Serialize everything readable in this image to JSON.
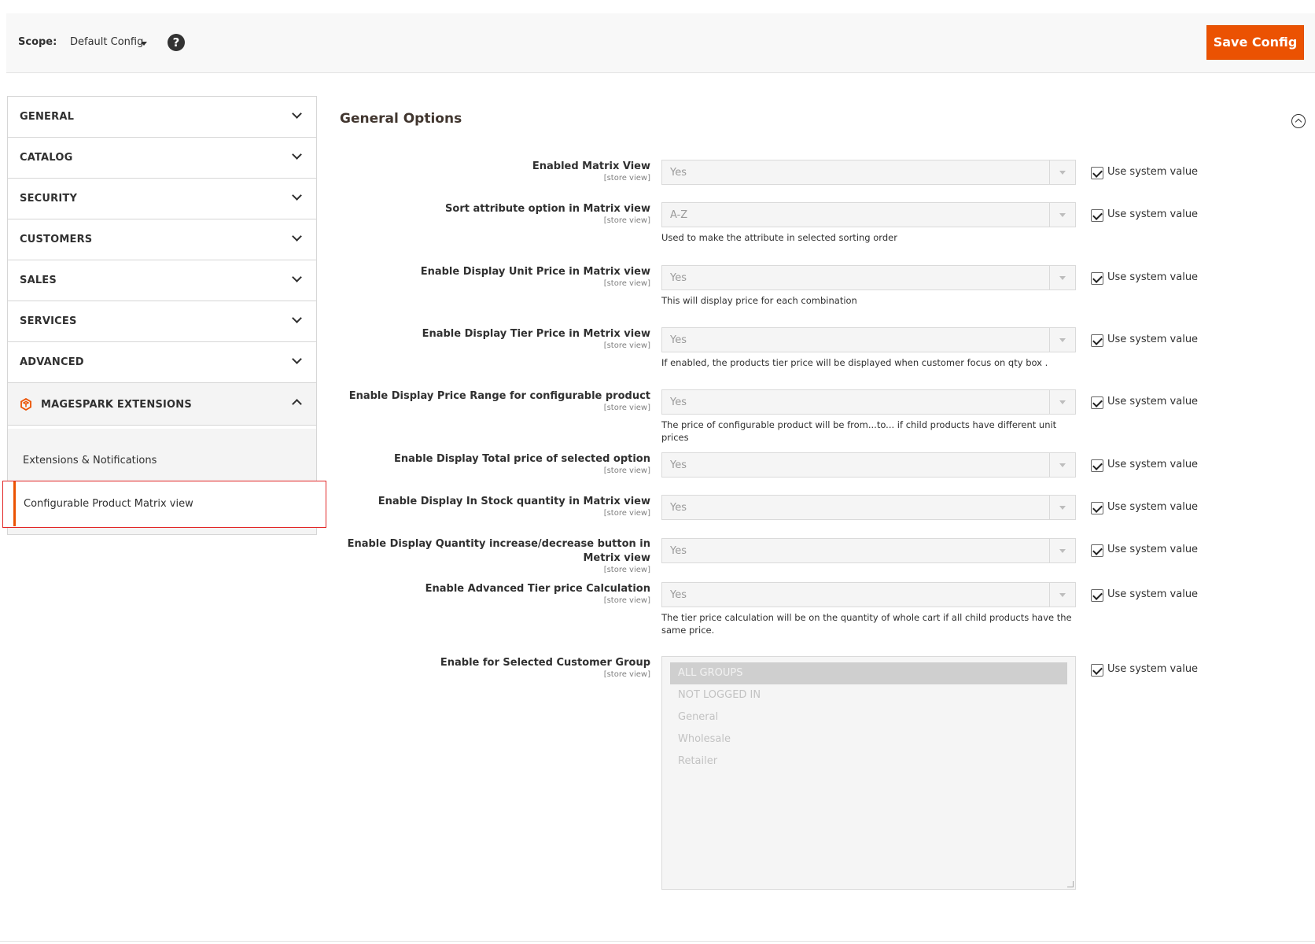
{
  "scope": {
    "label": "Scope:",
    "value": "Default Config",
    "help_icon": "question-circle-icon"
  },
  "header": {
    "save_label": "Save Config"
  },
  "sidebar": {
    "items": [
      {
        "label": "GENERAL"
      },
      {
        "label": "CATALOG"
      },
      {
        "label": "SECURITY"
      },
      {
        "label": "CUSTOMERS"
      },
      {
        "label": "SALES"
      },
      {
        "label": "SERVICES"
      },
      {
        "label": "ADVANCED"
      }
    ],
    "extension_group": {
      "label": "MAGESPARK EXTENSIONS",
      "icon": "magespark-logo-icon",
      "children": [
        {
          "label": "Extensions & Notifications"
        },
        {
          "label": "Configurable Product Matrix view",
          "active": true
        }
      ]
    }
  },
  "section": {
    "title": "General Options"
  },
  "use_system_label": "Use system value",
  "fields": [
    {
      "label": "Enabled Matrix View",
      "scope": "[store view]",
      "value": "Yes",
      "note": ""
    },
    {
      "label": "Sort attribute option in Matrix view",
      "scope": "[store view]",
      "value": "A-Z",
      "note": "Used to make the attribute in selected sorting order"
    },
    {
      "label": "Enable Display Unit Price in Matrix view",
      "scope": "[store view]",
      "value": "Yes",
      "note": "This will display price for each combination"
    },
    {
      "label": "Enable Display Tier Price in Metrix view",
      "scope": "[store view]",
      "value": "Yes",
      "note": "If enabled, the products tier price will be displayed when customer focus on qty box ."
    },
    {
      "label": "Enable Display Price Range for configurable product",
      "scope": "[store view]",
      "value": "Yes",
      "note": "The price of configurable product will be from...to... if child products have different unit prices"
    },
    {
      "label": "Enable Display Total price of selected option",
      "scope": "[store view]",
      "value": "Yes",
      "note": ""
    },
    {
      "label": "Enable Display In Stock quantity in Matrix view",
      "scope": "[store view]",
      "value": "Yes",
      "note": ""
    },
    {
      "label": "Enable Display Quantity increase/decrease button in Metrix view",
      "scope": "[store view]",
      "value": "Yes",
      "note": ""
    },
    {
      "label": "Enable Advanced Tier price Calculation",
      "scope": "[store view]",
      "value": "Yes",
      "note": "The tier price calculation will be on the quantity of whole cart if all child products have the same price."
    },
    {
      "label": "Enable for Selected Customer Group",
      "scope": "[store view]",
      "options": [
        "ALL GROUPS",
        "NOT LOGGED IN",
        "General",
        "Wholesale",
        "Retailer"
      ],
      "selected": "ALL GROUPS"
    }
  ],
  "colors": {
    "accent": "#eb5202",
    "highlight_border": "#e22626"
  }
}
